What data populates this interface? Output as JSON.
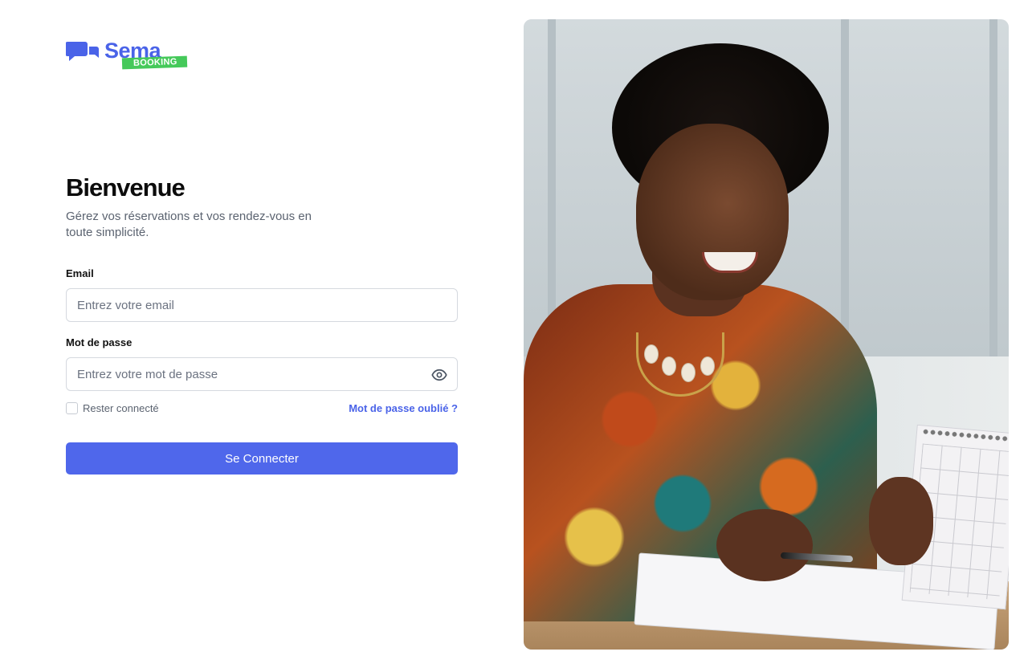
{
  "brand": {
    "name": "Sema",
    "badge": "BOOKING",
    "color": "#4a63e8",
    "badge_color": "#45c95a"
  },
  "welcome": {
    "title": "Bienvenue",
    "subtitle": "Gérez vos réservations et vos rendez-vous en toute simplicité."
  },
  "form": {
    "email_label": "Email",
    "email_placeholder": "Entrez votre email",
    "password_label": "Mot de passe",
    "password_placeholder": "Entrez votre mot de passe",
    "remember_label": "Rester connecté",
    "forgot_label": "Mot de passe oublié ?",
    "submit_label": "Se Connecter",
    "accent": "#4f67eb"
  },
  "icons": {
    "logo": "chat-bubbles-icon",
    "password_toggle": "eye-icon"
  }
}
